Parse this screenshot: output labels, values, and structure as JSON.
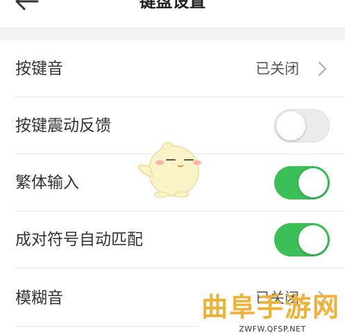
{
  "header": {
    "title": "键盘设置"
  },
  "settings": {
    "key_sound": {
      "label": "按键音",
      "value": "已关闭"
    },
    "key_vibration": {
      "label": "按键震动反馈",
      "state": "off"
    },
    "traditional_input": {
      "label": "繁体输入",
      "state": "on"
    },
    "pair_symbols": {
      "label": "成对符号自动匹配",
      "state": "on"
    },
    "fuzzy_sound": {
      "label": "模糊音",
      "value": "已关闭"
    }
  },
  "watermark": {
    "text": "曲阜手游网",
    "url": "ZWFW.QFSP.NET"
  },
  "colors": {
    "toggle_on": "#3cbe58",
    "toggle_off": "#ebebeb",
    "watermark": "#ecb23c"
  }
}
